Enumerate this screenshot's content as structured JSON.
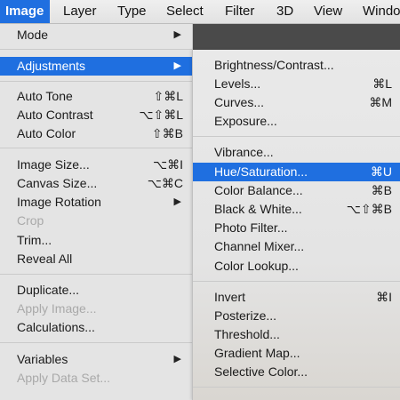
{
  "menubar": {
    "items": [
      "Image",
      "Layer",
      "Type",
      "Select",
      "Filter",
      "3D",
      "View",
      "Windo"
    ]
  },
  "image_menu": {
    "items": [
      {
        "label": "Mode",
        "has_submenu": true
      },
      {
        "label": "Adjustments",
        "has_submenu": true,
        "highlighted": true
      },
      {
        "label": "Auto Tone",
        "shortcut": "⇧⌘L"
      },
      {
        "label": "Auto Contrast",
        "shortcut": "⌥⇧⌘L"
      },
      {
        "label": "Auto Color",
        "shortcut": "⇧⌘B"
      },
      {
        "label": "Image Size...",
        "shortcut": "⌥⌘I"
      },
      {
        "label": "Canvas Size...",
        "shortcut": "⌥⌘C"
      },
      {
        "label": "Image Rotation",
        "has_submenu": true
      },
      {
        "label": "Crop",
        "disabled": true
      },
      {
        "label": "Trim..."
      },
      {
        "label": "Reveal All"
      },
      {
        "label": "Duplicate..."
      },
      {
        "label": "Apply Image...",
        "disabled": true
      },
      {
        "label": "Calculations..."
      },
      {
        "label": "Variables",
        "has_submenu": true
      },
      {
        "label": "Apply Data Set...",
        "disabled": true
      }
    ]
  },
  "adjustments_submenu": {
    "items": [
      {
        "label": "Brightness/Contrast..."
      },
      {
        "label": "Levels...",
        "shortcut": "⌘L"
      },
      {
        "label": "Curves...",
        "shortcut": "⌘M"
      },
      {
        "label": "Exposure..."
      },
      {
        "label": "Vibrance..."
      },
      {
        "label": "Hue/Saturation...",
        "shortcut": "⌘U",
        "highlighted": true
      },
      {
        "label": "Color Balance...",
        "shortcut": "⌘B"
      },
      {
        "label": "Black & White...",
        "shortcut": "⌥⇧⌘B"
      },
      {
        "label": "Photo Filter..."
      },
      {
        "label": "Channel Mixer..."
      },
      {
        "label": "Color Lookup..."
      },
      {
        "label": "Invert",
        "shortcut": "⌘I"
      },
      {
        "label": "Posterize..."
      },
      {
        "label": "Threshold..."
      },
      {
        "label": "Gradient Map..."
      },
      {
        "label": "Selective Color..."
      }
    ]
  },
  "colors": {
    "highlight": "#1f6fe0",
    "menu_bg": "#e8e8e8",
    "disabled_text": "#a9a9a9"
  }
}
